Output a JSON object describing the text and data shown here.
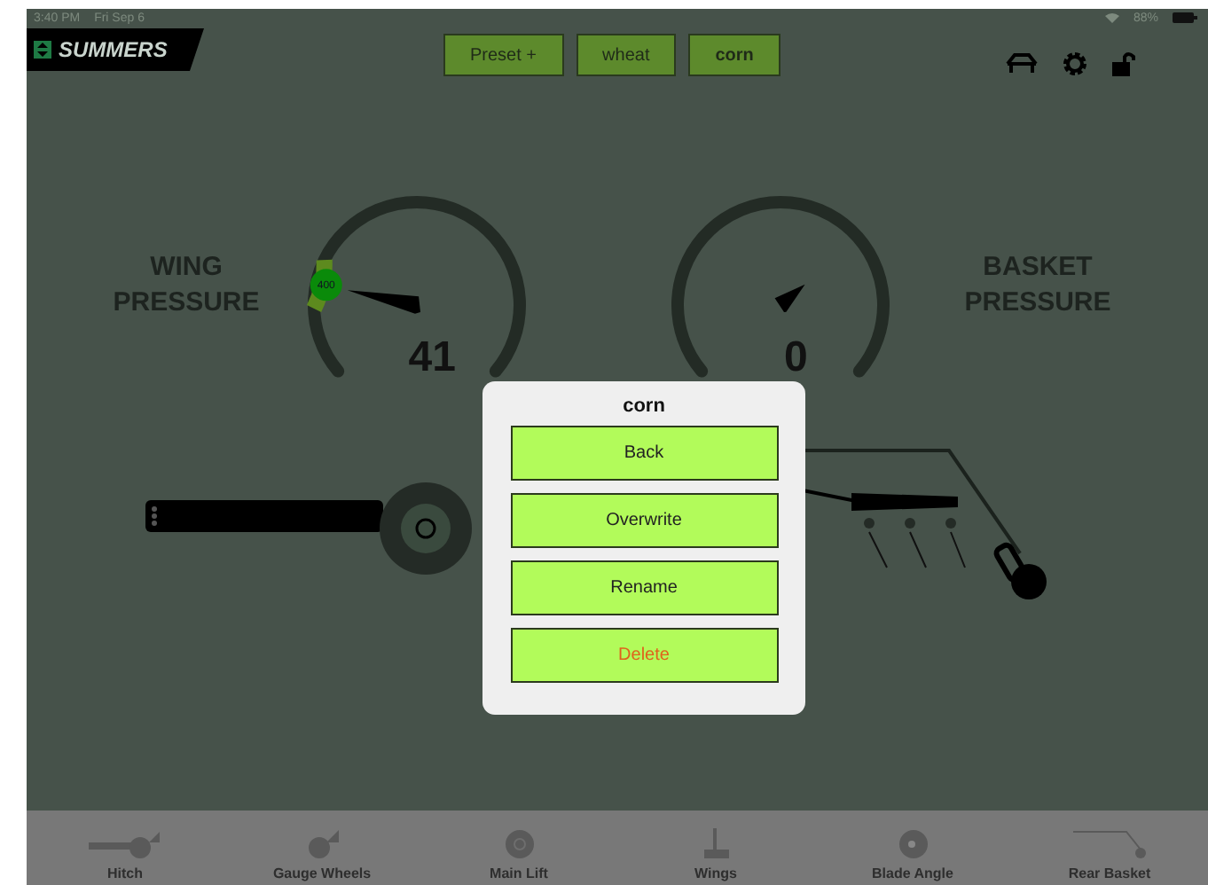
{
  "status_bar": {
    "time": "3:40 PM",
    "date": "Fri Sep 6",
    "battery": "88%"
  },
  "header": {
    "logo": "SUMMERS",
    "presets": [
      {
        "label": "Preset +",
        "selected": false
      },
      {
        "label": "wheat",
        "selected": false
      },
      {
        "label": "corn",
        "selected": true
      }
    ]
  },
  "gauges": [
    {
      "label": "WING PRESSURE",
      "reading": "41",
      "setpoint": "400"
    },
    {
      "label": "BASKET PRESSURE",
      "reading": "0"
    }
  ],
  "dialog": {
    "title": "corn",
    "buttons": [
      {
        "label": "Back",
        "kind": "normal"
      },
      {
        "label": "Overwrite",
        "kind": "normal"
      },
      {
        "label": "Rename",
        "kind": "normal"
      },
      {
        "label": "Delete",
        "kind": "destructive"
      }
    ]
  },
  "nav": [
    {
      "label": "Hitch",
      "kind": "hitch"
    },
    {
      "label": "Gauge Wheels",
      "kind": "gauge-wheels"
    },
    {
      "label": "Main Lift",
      "kind": "main-lift"
    },
    {
      "label": "Wings",
      "kind": "wings"
    },
    {
      "label": "Blade Angle",
      "kind": "blade-angle"
    },
    {
      "label": "Rear Basket",
      "kind": "rear-basket"
    }
  ]
}
